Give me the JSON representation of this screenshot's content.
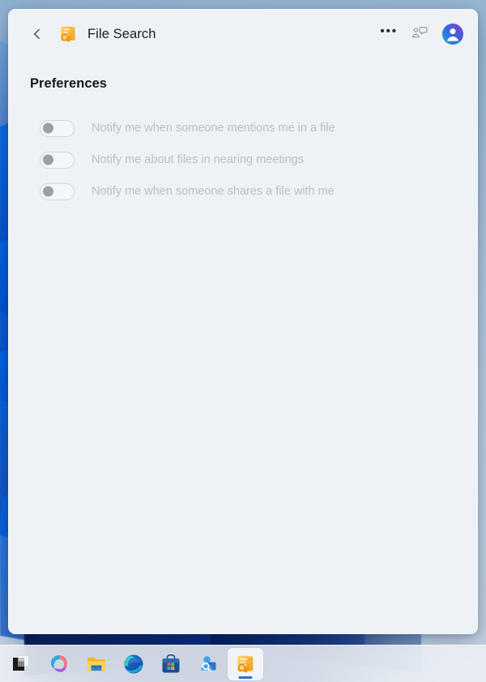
{
  "window": {
    "title": "File Search",
    "app_icon": "file-search-app-icon",
    "back_icon": "chevron-left-icon"
  },
  "titlebar": {
    "more_label": "•••",
    "more_icon": "more-options-icon",
    "feedback_icon": "feedback-person-chat-icon",
    "avatar_icon": "account-avatar-icon"
  },
  "main": {
    "page_title": "Preferences",
    "preferences": [
      {
        "label": "Notify me when someone mentions me in a file",
        "state": "off",
        "enabled": false
      },
      {
        "label": "Notify me about files in nearing meetings",
        "state": "off",
        "enabled": false
      },
      {
        "label": "Notify me when someone shares a file with me",
        "state": "off",
        "enabled": false
      }
    ]
  },
  "taskbar": {
    "items": [
      {
        "name": "start-button",
        "icon": "windows-start-icon",
        "running": false,
        "active": false
      },
      {
        "name": "copilot-button",
        "icon": "copilot-icon",
        "running": false,
        "active": false
      },
      {
        "name": "file-explorer-button",
        "icon": "file-explorer-icon",
        "running": false,
        "active": false
      },
      {
        "name": "edge-button",
        "icon": "microsoft-edge-icon",
        "running": true,
        "active": false
      },
      {
        "name": "store-button",
        "icon": "microsoft-store-icon",
        "running": false,
        "active": false
      },
      {
        "name": "people-search-button",
        "icon": "people-search-icon",
        "running": true,
        "active": false
      },
      {
        "name": "file-search-button",
        "icon": "file-search-app-icon",
        "running": true,
        "active": true
      }
    ]
  },
  "colors": {
    "window_bg": "#eef2f7",
    "title_text": "#1a1a1a",
    "disabled_text": "#b9bfc6",
    "accent": "#2a6fc9",
    "app_icon_orange": "#f0a020",
    "desktop_blue": "#0050c8"
  }
}
